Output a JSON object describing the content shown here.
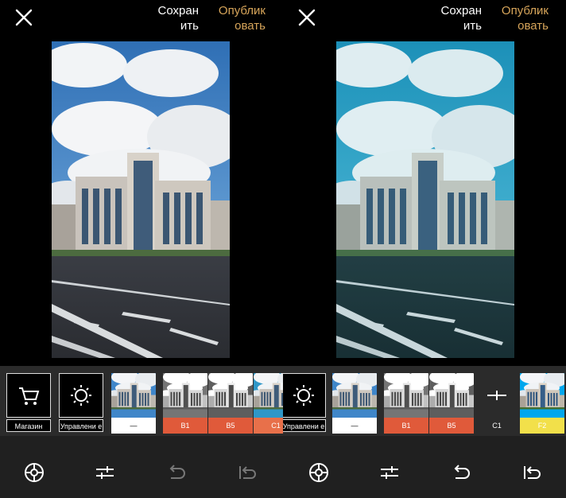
{
  "left": {
    "header": {
      "save_label": "Сохран\nить",
      "publish_label": "Опублик\nовать"
    },
    "tools": [
      {
        "icon": "cart-icon",
        "label": "Магазин"
      },
      {
        "icon": "brightness-icon",
        "label": "Управлени\nе"
      }
    ],
    "filters": [
      {
        "label": "—",
        "label_bg": "#ffffff",
        "label_color": "#000000",
        "tone": "original"
      },
      {
        "label": "B1",
        "label_bg": "#e05a3a",
        "label_color": "#ffffff",
        "tone": "bw"
      },
      {
        "label": "B5",
        "label_bg": "#e05a3a",
        "label_color": "#ffffff",
        "tone": "bw"
      },
      {
        "label": "C1",
        "label_bg": "#e8704a",
        "label_color": "#ffffff",
        "tone": "original"
      }
    ],
    "bottom_icons": [
      "filter-wheel-icon",
      "adjust-icon",
      "undo-icon",
      "undo-all-icon"
    ]
  },
  "right": {
    "header": {
      "save_label": "Сохран\nить",
      "publish_label": "Опублик\nовать"
    },
    "tools": [
      {
        "icon": "brightness-icon",
        "label": "Управлени\nе"
      }
    ],
    "filters": [
      {
        "label": "—",
        "label_bg": "#ffffff",
        "label_color": "#000000",
        "tone": "original"
      },
      {
        "label": "B1",
        "label_bg": "#e05a3a",
        "label_color": "#ffffff",
        "tone": "bw"
      },
      {
        "label": "B5",
        "label_bg": "#e05a3a",
        "label_color": "#ffffff",
        "tone": "bw"
      },
      {
        "label": "C1",
        "label_bg": "#2b2b2b",
        "label_color": "#ffffff",
        "tone": "selected"
      },
      {
        "label": "F2",
        "label_bg": "#f2e04a",
        "label_color": "#ffffff",
        "tone": "original"
      }
    ],
    "bottom_icons": [
      "filter-wheel-icon",
      "adjust-icon",
      "undo-icon",
      "undo-all-icon"
    ]
  },
  "colors": {
    "accent": "#d7a55a",
    "toolbar_bg": "#2b2b2b",
    "bottom_bg": "#202020",
    "filter_red": "#e05a3a",
    "filter_yellow": "#f2e04a"
  }
}
